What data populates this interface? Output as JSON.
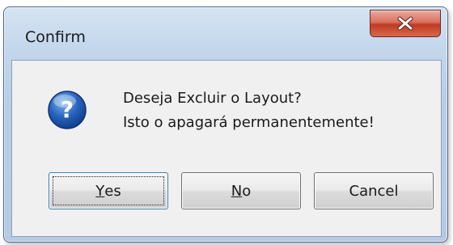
{
  "window": {
    "title": "Confirm"
  },
  "message": {
    "line1": "Deseja Excluir o Layout?",
    "line2": "Isto o apagará permanentemente!",
    "icon": "question-icon"
  },
  "buttons": {
    "yes": {
      "mnemonic": "Y",
      "rest": "es"
    },
    "no": {
      "mnemonic": "N",
      "rest": "o"
    },
    "cancel": {
      "label": "Cancel"
    }
  },
  "close_button": {
    "icon": "close-icon",
    "color": "#c9432b"
  }
}
